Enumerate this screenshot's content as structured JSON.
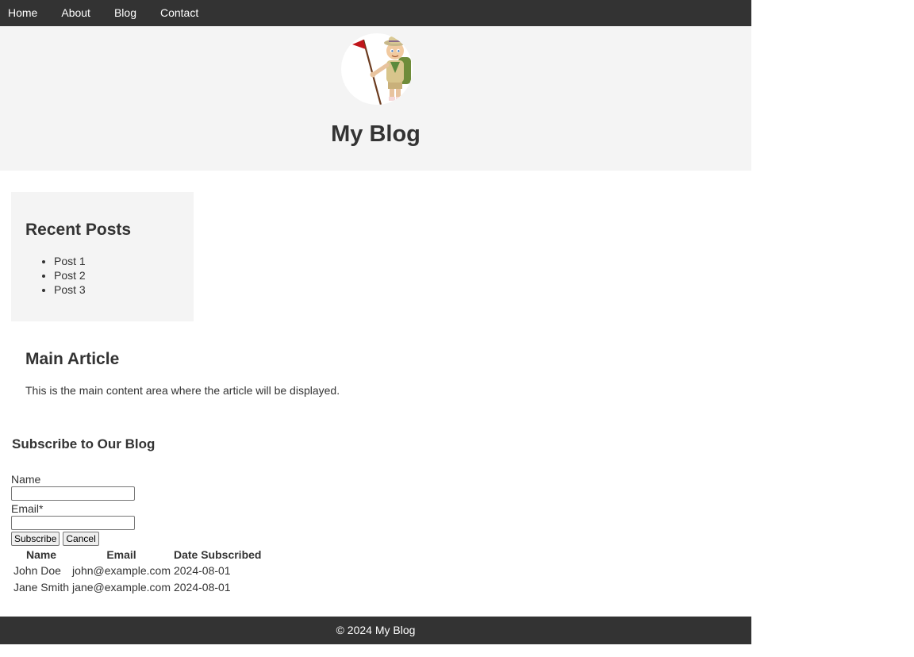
{
  "nav": {
    "items": [
      {
        "label": "Home"
      },
      {
        "label": "About"
      },
      {
        "label": "Blog"
      },
      {
        "label": "Contact"
      }
    ]
  },
  "header": {
    "title": "My Blog",
    "avatar_icon": "scout-hiker-with-flag-illustration"
  },
  "sidebar": {
    "title": "Recent Posts",
    "posts": [
      {
        "label": "Post 1"
      },
      {
        "label": "Post 2"
      },
      {
        "label": "Post 3"
      }
    ]
  },
  "article": {
    "title": "Main Article",
    "body": "This is the main content area where the article will be displayed."
  },
  "subscribe": {
    "title": "Subscribe to Our Blog",
    "name_label": "Name",
    "name_value": "",
    "email_label": "Email*",
    "email_value": "",
    "subscribe_button": "Subscribe",
    "cancel_button": "Cancel",
    "table": {
      "headers": [
        "Name",
        "Email",
        "Date Subscribed"
      ],
      "rows": [
        [
          "John Doe",
          "john@example.com",
          "2024-08-01"
        ],
        [
          "Jane Smith",
          "jane@example.com",
          "2024-08-01"
        ]
      ]
    }
  },
  "footer": {
    "text": "© 2024 My Blog"
  },
  "colors": {
    "nav_bg": "#333333",
    "header_bg": "#f4f4f4",
    "text": "#333333",
    "flag": "#c0161b"
  }
}
